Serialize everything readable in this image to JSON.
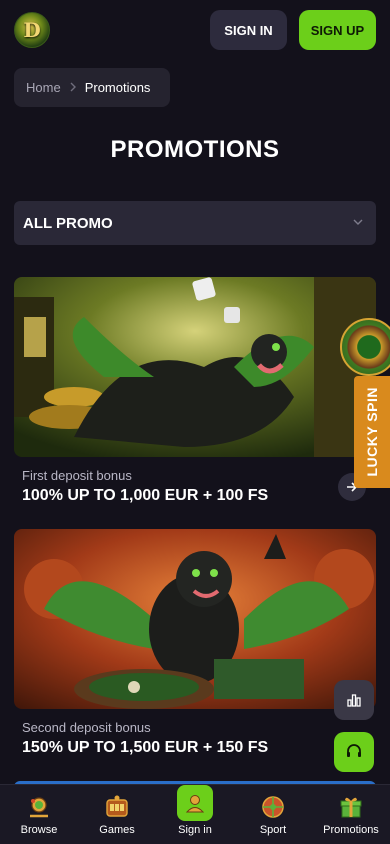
{
  "header": {
    "logo_letter": "D",
    "sign_in": "SIGN IN",
    "sign_up": "SIGN UP"
  },
  "breadcrumb": {
    "home": "Home",
    "current": "Promotions"
  },
  "page_title": "PROMOTIONS",
  "filter": {
    "selected": "ALL PROMO"
  },
  "promos": [
    {
      "label": "First deposit bonus",
      "title": "100% UP TO 1,000 EUR + 100 FS"
    },
    {
      "label": "Second deposit bonus",
      "title": "150% UP TO 1,500 EUR + 150 FS"
    }
  ],
  "lucky_spin": "LUCKY SPIN",
  "bottom_nav": [
    {
      "label": "Browse",
      "icon": "browse-icon"
    },
    {
      "label": "Games",
      "icon": "games-icon"
    },
    {
      "label": "Sign in",
      "icon": "user-icon"
    },
    {
      "label": "Sport",
      "icon": "ball-icon"
    },
    {
      "label": "Promotions",
      "icon": "gift-icon"
    }
  ],
  "colors": {
    "background": "#13111b",
    "accent_green": "#6ccf1a",
    "lucky_orange": "#d98a1d"
  }
}
